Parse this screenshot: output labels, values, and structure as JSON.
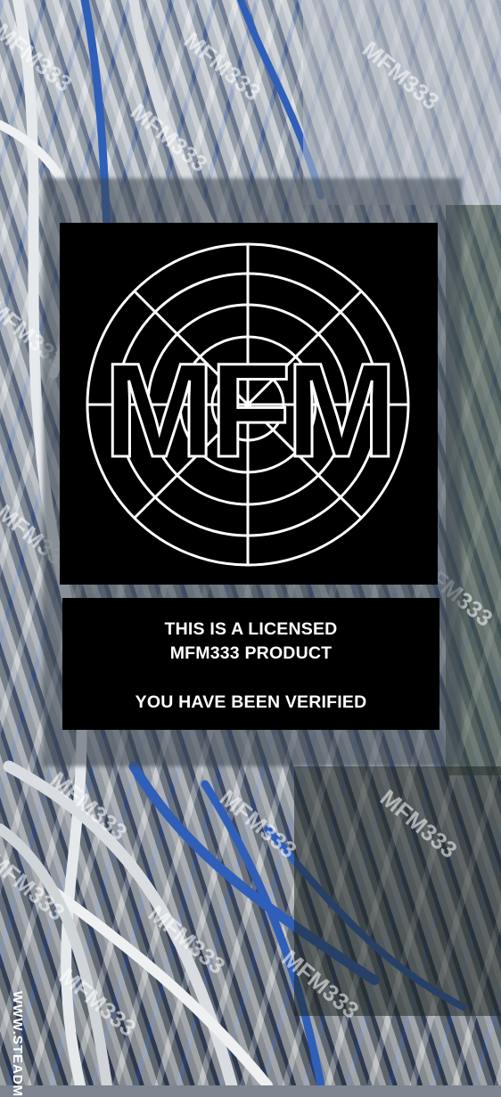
{
  "logo": {
    "letters": "MFM"
  },
  "verification": {
    "line1": "THIS IS A LICENSED",
    "line2": "MFM333 PRODUCT",
    "line3": "YOU HAVE BEEN VERIFIED"
  },
  "watermark": {
    "text": "MFM333"
  },
  "side_credit": "WWW.STEADM",
  "colors": {
    "panel": "#000000",
    "text": "#ffffff",
    "cable_blue": "#2f5fb8",
    "cable_grey": "#d9dde2"
  }
}
